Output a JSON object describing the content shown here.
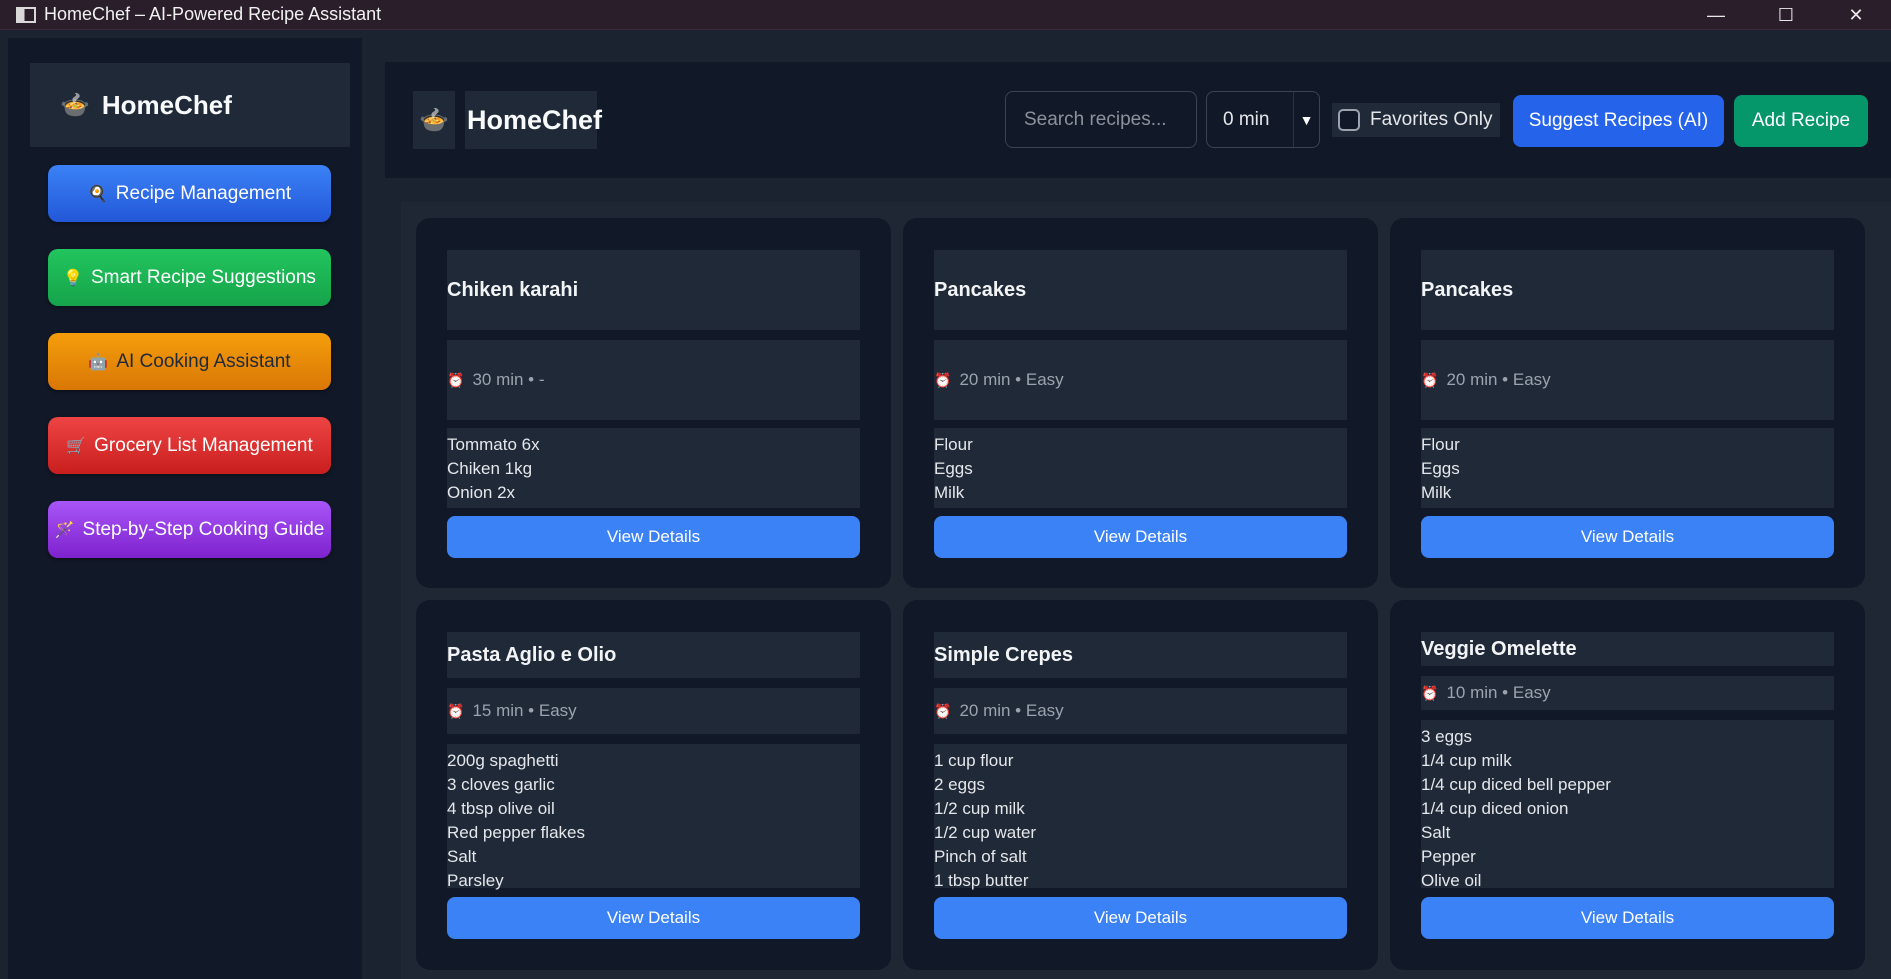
{
  "window": {
    "title": "HomeChef – AI-Powered Recipe Assistant",
    "controls": [
      "—",
      "☐",
      "✕"
    ]
  },
  "sidebar": {
    "brand_icon": "🍲",
    "brand_name": "HomeChef",
    "items": [
      {
        "icon": "🍳",
        "label": "Recipe Management",
        "color": "#2563eb"
      },
      {
        "icon": "💡",
        "label": "Smart Recipe Suggestions",
        "color": "#16a34a"
      },
      {
        "icon": "🤖",
        "label": "AI Cooking Assistant",
        "color": "#d97706"
      },
      {
        "icon": "🛒",
        "label": "Grocery List Management",
        "color": "#dc2626"
      },
      {
        "icon": "🪄",
        "label": "Step-by-Step Cooking Guide",
        "color": "#9333ea"
      }
    ]
  },
  "header": {
    "logo_icon": "🍲",
    "title": "HomeChef",
    "search_placeholder": "Search recipes...",
    "time_filter": "0 min",
    "favorites_label": "Favorites Only",
    "favorites_checked": false,
    "suggest_label": "Suggest Recipes (AI)",
    "add_label": "Add Recipe"
  },
  "recipes": [
    {
      "title": "Chiken karahi",
      "clock": "⏰",
      "meta": "30 min • -",
      "ingredients": [
        "Tommato 6x",
        "Chiken 1kg",
        "Onion 2x"
      ],
      "button": "View Details"
    },
    {
      "title": "Pancakes",
      "clock": "⏰",
      "meta": "20 min • Easy",
      "ingredients": [
        "Flour",
        "Eggs",
        "Milk"
      ],
      "button": "View Details"
    },
    {
      "title": "Pancakes",
      "clock": "⏰",
      "meta": "20 min • Easy",
      "ingredients": [
        "Flour",
        "Eggs",
        "Milk"
      ],
      "button": "View Details"
    },
    {
      "title": "Pasta Aglio e Olio",
      "clock": "⏰",
      "meta": "15 min • Easy",
      "ingredients": [
        "200g spaghetti",
        "3 cloves garlic",
        "4 tbsp olive oil",
        "Red pepper flakes",
        "Salt",
        "Parsley"
      ],
      "button": "View Details"
    },
    {
      "title": "Simple Crepes",
      "clock": "⏰",
      "meta": "20 min • Easy",
      "ingredients": [
        "1 cup flour",
        "2 eggs",
        "1/2 cup milk",
        "1/2 cup water",
        "Pinch of salt",
        "1 tbsp butter"
      ],
      "button": "View Details"
    },
    {
      "title": "Veggie Omelette",
      "clock": "⏰",
      "meta": "10 min • Easy",
      "ingredients": [
        "3 eggs",
        "1/4 cup milk",
        "1/4 cup diced bell pepper",
        "1/4 cup diced onion",
        "Salt",
        "Pepper",
        "Olive oil"
      ],
      "button": "View Details"
    }
  ]
}
